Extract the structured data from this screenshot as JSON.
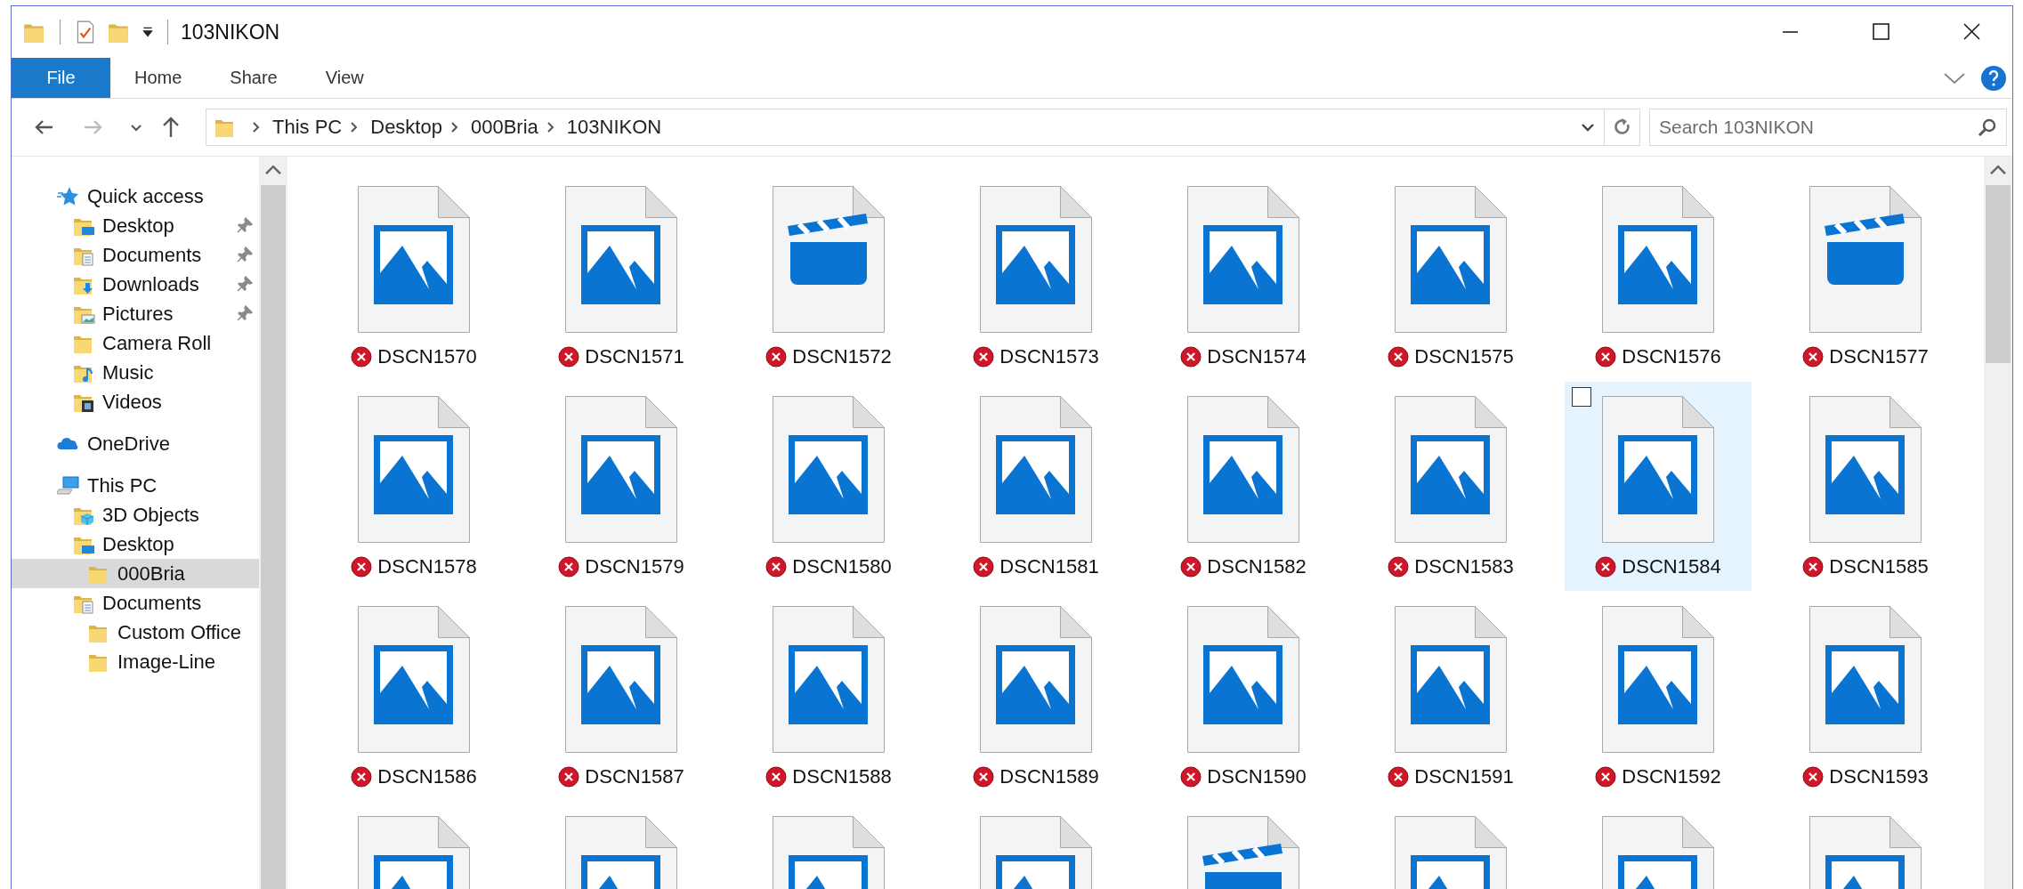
{
  "window": {
    "title": "103NIKON"
  },
  "ribbon": {
    "tabs": [
      {
        "label": "File",
        "kind": "menu",
        "selected": false
      },
      {
        "label": "Home",
        "kind": "tab",
        "selected": false
      },
      {
        "label": "Share",
        "kind": "tab",
        "selected": false
      },
      {
        "label": "View",
        "kind": "tab",
        "selected": false
      }
    ]
  },
  "address": {
    "path": [
      "This PC",
      "Desktop",
      "000Bria",
      "103NIKON"
    ]
  },
  "search": {
    "placeholder": "Search 103NIKON"
  },
  "navigation": [
    {
      "label": "Quick access",
      "kind": "star",
      "pinned": false,
      "selected": false,
      "children": [
        {
          "label": "Desktop",
          "kind": "desktop",
          "pinned": true,
          "selected": false
        },
        {
          "label": "Documents",
          "kind": "documents",
          "pinned": true,
          "selected": false
        },
        {
          "label": "Downloads",
          "kind": "downloads",
          "pinned": true,
          "selected": false
        },
        {
          "label": "Pictures",
          "kind": "pictures",
          "pinned": true,
          "selected": false
        },
        {
          "label": "Camera Roll",
          "kind": "folder",
          "pinned": false,
          "selected": false
        },
        {
          "label": "Music",
          "kind": "music",
          "pinned": false,
          "selected": false
        },
        {
          "label": "Videos",
          "kind": "videos",
          "pinned": false,
          "selected": false
        }
      ]
    },
    {
      "label": "OneDrive",
      "kind": "cloud",
      "pinned": false,
      "selected": false
    },
    {
      "label": "This PC",
      "kind": "pc",
      "pinned": false,
      "selected": false,
      "children": [
        {
          "label": "3D Objects",
          "kind": "objects",
          "pinned": false,
          "selected": false
        },
        {
          "label": "Desktop",
          "kind": "desktop",
          "pinned": false,
          "selected": false,
          "children": [
            {
              "label": "000Bria",
              "kind": "folder",
              "pinned": false,
              "selected": true
            }
          ]
        },
        {
          "label": "Documents",
          "kind": "documents",
          "pinned": false,
          "selected": false,
          "children": [
            {
              "label": "Custom Office",
              "kind": "folder",
              "pinned": false,
              "selected": false
            },
            {
              "label": "Image-Line",
              "kind": "folder",
              "pinned": false,
              "selected": false
            }
          ]
        }
      ]
    }
  ],
  "files": [
    {
      "name": "DSCN1570",
      "kind": "image",
      "error": true,
      "selected": false
    },
    {
      "name": "DSCN1571",
      "kind": "image",
      "error": true,
      "selected": false
    },
    {
      "name": "DSCN1572",
      "kind": "video",
      "error": true,
      "selected": false
    },
    {
      "name": "DSCN1573",
      "kind": "image",
      "error": true,
      "selected": false
    },
    {
      "name": "DSCN1574",
      "kind": "image",
      "error": true,
      "selected": false
    },
    {
      "name": "DSCN1575",
      "kind": "image",
      "error": true,
      "selected": false
    },
    {
      "name": "DSCN1576",
      "kind": "image",
      "error": true,
      "selected": false
    },
    {
      "name": "DSCN1577",
      "kind": "video",
      "error": true,
      "selected": false
    },
    {
      "name": "DSCN1578",
      "kind": "image",
      "error": true,
      "selected": false
    },
    {
      "name": "DSCN1579",
      "kind": "image",
      "error": true,
      "selected": false
    },
    {
      "name": "DSCN1580",
      "kind": "image",
      "error": true,
      "selected": false
    },
    {
      "name": "DSCN1581",
      "kind": "image",
      "error": true,
      "selected": false
    },
    {
      "name": "DSCN1582",
      "kind": "image",
      "error": true,
      "selected": false
    },
    {
      "name": "DSCN1583",
      "kind": "image",
      "error": true,
      "selected": false
    },
    {
      "name": "DSCN1584",
      "kind": "image",
      "error": true,
      "selected": true
    },
    {
      "name": "DSCN1585",
      "kind": "image",
      "error": true,
      "selected": false
    },
    {
      "name": "DSCN1586",
      "kind": "image",
      "error": true,
      "selected": false
    },
    {
      "name": "DSCN1587",
      "kind": "image",
      "error": true,
      "selected": false
    },
    {
      "name": "DSCN1588",
      "kind": "image",
      "error": true,
      "selected": false
    },
    {
      "name": "DSCN1589",
      "kind": "image",
      "error": true,
      "selected": false
    },
    {
      "name": "DSCN1590",
      "kind": "image",
      "error": true,
      "selected": false
    },
    {
      "name": "DSCN1591",
      "kind": "image",
      "error": true,
      "selected": false
    },
    {
      "name": "DSCN1592",
      "kind": "image",
      "error": true,
      "selected": false
    },
    {
      "name": "DSCN1593",
      "kind": "image",
      "error": true,
      "selected": false
    },
    {
      "kind": "image",
      "selected": false
    },
    {
      "kind": "image",
      "selected": false
    },
    {
      "kind": "image",
      "selected": false
    },
    {
      "kind": "image",
      "selected": false
    },
    {
      "kind": "video",
      "selected": false
    },
    {
      "kind": "image",
      "selected": false
    },
    {
      "kind": "image",
      "selected": false
    },
    {
      "kind": "image",
      "selected": false
    }
  ]
}
